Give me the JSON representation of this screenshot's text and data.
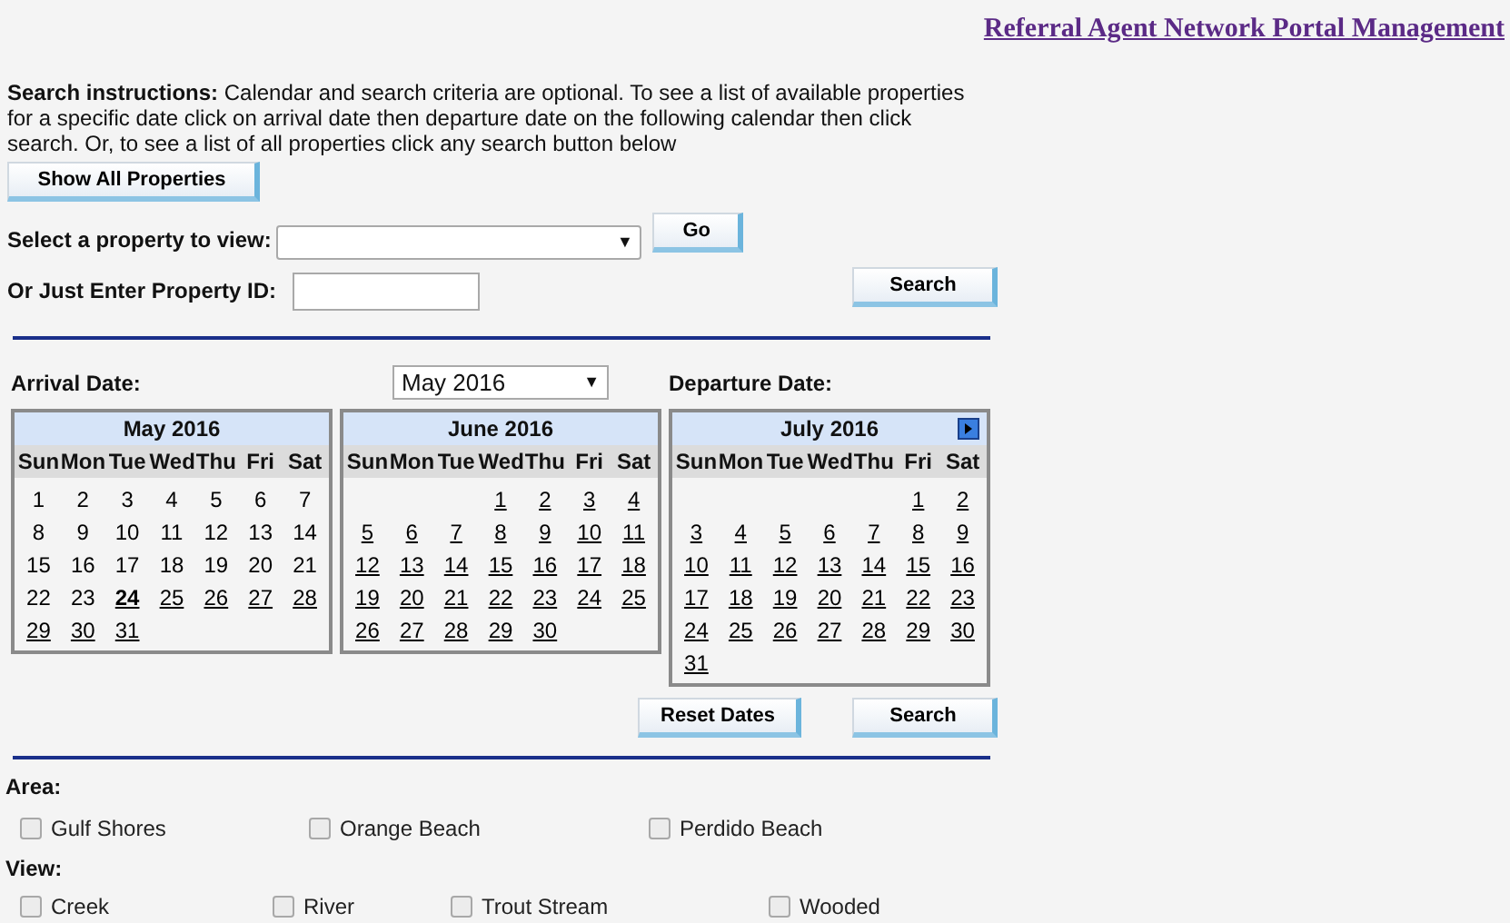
{
  "title_link": "Referral Agent Network Portal Management",
  "instructions": {
    "label": "Search instructions:",
    "text": "Calendar and search criteria are optional. To see a list of available properties for a specific date click on arrival date then departure date on the following calendar then click search. Or, to see a list of all properties click any search button below"
  },
  "show_all_button": "Show All Properties",
  "property_select": {
    "label": "Select a property to view:",
    "button": "Go"
  },
  "property_id": {
    "label": "Or Just Enter Property ID:",
    "button": "Search"
  },
  "arrival_label": "Arrival Date:",
  "month_select": "May 2016",
  "departure_label": "Departure Date:",
  "property_dropdown_arrow": "▼",
  "month_dropdown_arrow": "▼",
  "calendars": [
    {
      "title": "May 2016",
      "next_button": false,
      "weekdays": [
        "Sun",
        "Mon",
        "Tue",
        "Wed",
        "Thu",
        "Fri",
        "Sat"
      ],
      "weeks": [
        [
          {
            "d": "1",
            "kind": "plain"
          },
          {
            "d": "2",
            "kind": "plain"
          },
          {
            "d": "3",
            "kind": "plain"
          },
          {
            "d": "4",
            "kind": "plain"
          },
          {
            "d": "5",
            "kind": "plain"
          },
          {
            "d": "6",
            "kind": "plain"
          },
          {
            "d": "7",
            "kind": "plain"
          }
        ],
        [
          {
            "d": "8",
            "kind": "plain"
          },
          {
            "d": "9",
            "kind": "plain"
          },
          {
            "d": "10",
            "kind": "plain"
          },
          {
            "d": "11",
            "kind": "plain"
          },
          {
            "d": "12",
            "kind": "plain"
          },
          {
            "d": "13",
            "kind": "plain"
          },
          {
            "d": "14",
            "kind": "plain"
          }
        ],
        [
          {
            "d": "15",
            "kind": "plain"
          },
          {
            "d": "16",
            "kind": "plain"
          },
          {
            "d": "17",
            "kind": "plain"
          },
          {
            "d": "18",
            "kind": "plain"
          },
          {
            "d": "19",
            "kind": "plain"
          },
          {
            "d": "20",
            "kind": "plain"
          },
          {
            "d": "21",
            "kind": "plain"
          }
        ],
        [
          {
            "d": "22",
            "kind": "plain"
          },
          {
            "d": "23",
            "kind": "plain"
          },
          {
            "d": "24",
            "kind": "today"
          },
          {
            "d": "25",
            "kind": "link"
          },
          {
            "d": "26",
            "kind": "link"
          },
          {
            "d": "27",
            "kind": "link"
          },
          {
            "d": "28",
            "kind": "link"
          }
        ],
        [
          {
            "d": "29",
            "kind": "link"
          },
          {
            "d": "30",
            "kind": "link"
          },
          {
            "d": "31",
            "kind": "link"
          }
        ]
      ]
    },
    {
      "title": "June 2016",
      "next_button": false,
      "weekdays": [
        "Sun",
        "Mon",
        "Tue",
        "Wed",
        "Thu",
        "Fri",
        "Sat"
      ],
      "weeks": [
        [
          {
            "d": "1",
            "kind": "link"
          },
          {
            "d": "2",
            "kind": "link"
          },
          {
            "d": "3",
            "kind": "link"
          },
          {
            "d": "4",
            "kind": "link"
          }
        ],
        [
          {
            "d": "5",
            "kind": "link"
          },
          {
            "d": "6",
            "kind": "link"
          },
          {
            "d": "7",
            "kind": "link"
          },
          {
            "d": "8",
            "kind": "link"
          },
          {
            "d": "9",
            "kind": "link"
          },
          {
            "d": "10",
            "kind": "link"
          },
          {
            "d": "11",
            "kind": "link"
          }
        ],
        [
          {
            "d": "12",
            "kind": "link"
          },
          {
            "d": "13",
            "kind": "link"
          },
          {
            "d": "14",
            "kind": "link"
          },
          {
            "d": "15",
            "kind": "link"
          },
          {
            "d": "16",
            "kind": "link"
          },
          {
            "d": "17",
            "kind": "link"
          },
          {
            "d": "18",
            "kind": "link"
          }
        ],
        [
          {
            "d": "19",
            "kind": "link"
          },
          {
            "d": "20",
            "kind": "link"
          },
          {
            "d": "21",
            "kind": "link"
          },
          {
            "d": "22",
            "kind": "link"
          },
          {
            "d": "23",
            "kind": "link"
          },
          {
            "d": "24",
            "kind": "link"
          },
          {
            "d": "25",
            "kind": "link"
          }
        ],
        [
          {
            "d": "26",
            "kind": "link"
          },
          {
            "d": "27",
            "kind": "link"
          },
          {
            "d": "28",
            "kind": "link"
          },
          {
            "d": "29",
            "kind": "link"
          },
          {
            "d": "30",
            "kind": "link"
          }
        ]
      ]
    },
    {
      "title": "July 2016",
      "next_button": true,
      "weekdays": [
        "Sun",
        "Mon",
        "Tue",
        "Wed",
        "Thu",
        "Fri",
        "Sat"
      ],
      "weeks": [
        [
          {
            "d": "1",
            "kind": "link"
          },
          {
            "d": "2",
            "kind": "link"
          }
        ],
        [
          {
            "d": "3",
            "kind": "link"
          },
          {
            "d": "4",
            "kind": "link"
          },
          {
            "d": "5",
            "kind": "link"
          },
          {
            "d": "6",
            "kind": "link"
          },
          {
            "d": "7",
            "kind": "link"
          },
          {
            "d": "8",
            "kind": "link"
          },
          {
            "d": "9",
            "kind": "link"
          }
        ],
        [
          {
            "d": "10",
            "kind": "link"
          },
          {
            "d": "11",
            "kind": "link"
          },
          {
            "d": "12",
            "kind": "link"
          },
          {
            "d": "13",
            "kind": "link"
          },
          {
            "d": "14",
            "kind": "link"
          },
          {
            "d": "15",
            "kind": "link"
          },
          {
            "d": "16",
            "kind": "link"
          }
        ],
        [
          {
            "d": "17",
            "kind": "link"
          },
          {
            "d": "18",
            "kind": "link"
          },
          {
            "d": "19",
            "kind": "link"
          },
          {
            "d": "20",
            "kind": "link"
          },
          {
            "d": "21",
            "kind": "link"
          },
          {
            "d": "22",
            "kind": "link"
          },
          {
            "d": "23",
            "kind": "link"
          }
        ],
        [
          {
            "d": "24",
            "kind": "link"
          },
          {
            "d": "25",
            "kind": "link"
          },
          {
            "d": "26",
            "kind": "link"
          },
          {
            "d": "27",
            "kind": "link"
          },
          {
            "d": "28",
            "kind": "link"
          },
          {
            "d": "29",
            "kind": "link"
          },
          {
            "d": "30",
            "kind": "link"
          }
        ],
        [
          {
            "d": "31",
            "kind": "link"
          }
        ]
      ]
    }
  ],
  "reset_button": "Reset Dates",
  "search_button": "Search",
  "area": {
    "label": "Area:",
    "options": [
      {
        "label": "Gulf Shores",
        "checked": false
      },
      {
        "label": "Orange Beach",
        "checked": false
      },
      {
        "label": "Perdido Beach",
        "checked": false
      }
    ]
  },
  "view": {
    "label": "View:",
    "options": [
      {
        "label": "Creek",
        "checked": false
      },
      {
        "label": "River",
        "checked": false
      },
      {
        "label": "Trout Stream",
        "checked": false
      },
      {
        "label": "Wooded",
        "checked": false
      }
    ]
  }
}
